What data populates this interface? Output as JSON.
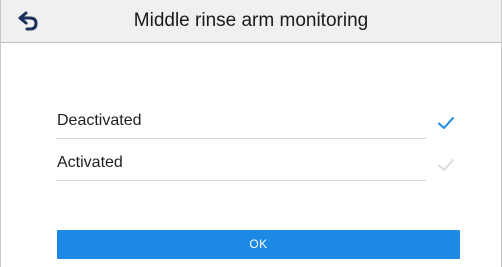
{
  "header": {
    "title": "Middle rinse arm monitoring",
    "back_icon": "back-arrow-icon"
  },
  "options": [
    {
      "label": "Deactivated",
      "selected": true,
      "check_color": "#1e88e5"
    },
    {
      "label": "Activated",
      "selected": false,
      "check_color": "#dcdcdc"
    }
  ],
  "ok_button": {
    "label": "OK",
    "color": "#1e88e5"
  }
}
